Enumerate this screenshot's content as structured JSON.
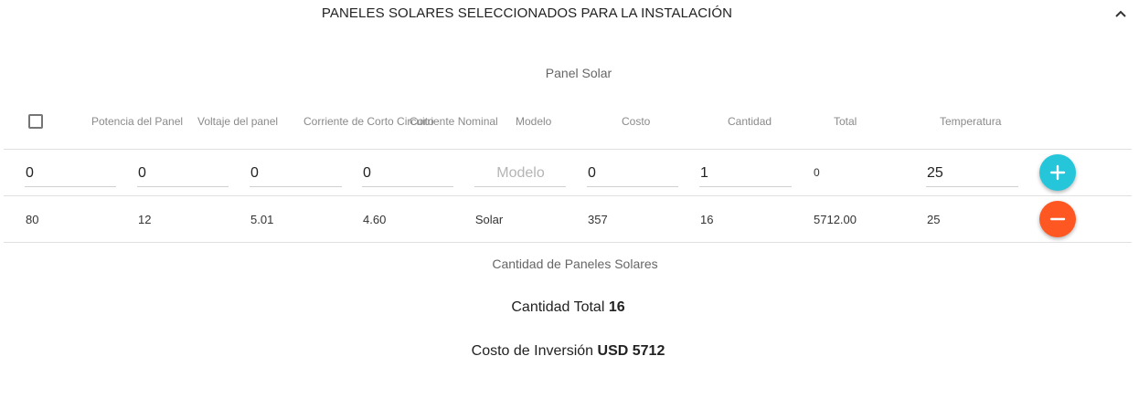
{
  "header": {
    "title": "PANELES SOLARES SELECCIONADOS PARA LA INSTALACIÓN",
    "collapse_icon": "chevron-up-icon"
  },
  "section_title": "Panel Solar",
  "columns": {
    "potencia": "Potencia del Panel",
    "voltaje": "Voltaje del panel",
    "corriente_corto": "Corriente de Corto Circuito",
    "corriente_nominal": "Corriente Nominal",
    "modelo": "Modelo",
    "costo": "Costo",
    "cantidad": "Cantidad",
    "total": "Total",
    "temperatura": "Temperatura"
  },
  "input_row": {
    "potencia": "0",
    "voltaje": "0",
    "corriente_corto": "0",
    "corriente_nominal": "0",
    "modelo_placeholder": "Modelo",
    "costo": "0",
    "cantidad": "1",
    "total": "0",
    "temperatura": "25",
    "add_icon": "plus-icon",
    "add_color": "#26c6da"
  },
  "rows": [
    {
      "potencia": "80",
      "voltaje": "12",
      "corriente_corto": "5.01",
      "corriente_nominal": "4.60",
      "modelo": "Solar",
      "costo": "357",
      "cantidad": "16",
      "total": "5712.00",
      "temperatura": "25",
      "remove_icon": "minus-icon",
      "remove_color": "#ff5722"
    }
  ],
  "summary": {
    "title": "Cantidad de Paneles Solares",
    "total_label": "Cantidad Total",
    "total_value": "16",
    "investment_label": "Costo de Inversión",
    "investment_value": "USD 5712"
  }
}
